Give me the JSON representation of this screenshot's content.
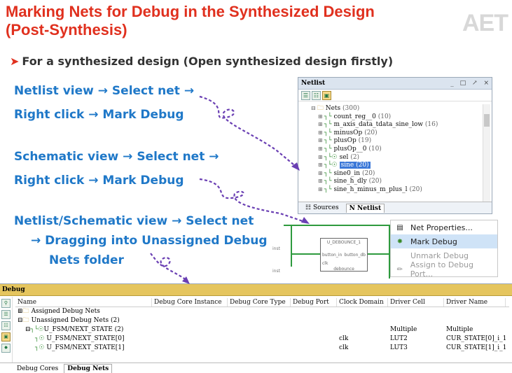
{
  "slide": {
    "title_line1": "Marking Nets for Debug in the Synthesized Design",
    "title_line2": "(Post-Synthesis)",
    "logo": "AET",
    "subtitle": "For a synthesized design (Open synthesized design firstly)",
    "instructions": [
      "Netlist view → Select net →",
      "Right click → Mark Debug",
      "Schematic view → Select net →",
      "Right click → Mark Debug",
      "Netlist/Schematic view → Select net",
      "→ Dragging into Unassigned Debug",
      "Nets folder"
    ],
    "accent_color": "#e0301e",
    "instruction_color": "#1f78c8",
    "arrow_color": "#6a3fb3"
  },
  "netlist": {
    "title": "Netlist",
    "window_buttons": [
      "_",
      "□",
      "↗",
      "×"
    ],
    "root": {
      "label": "Nets",
      "count": "(300)"
    },
    "items": [
      {
        "label": "count_reg__0",
        "count": "(10)",
        "selected": false
      },
      {
        "label": "m_axis_data_tdata_sine_low",
        "count": "(16)",
        "selected": false
      },
      {
        "label": "minusOp",
        "count": "(20)",
        "selected": false
      },
      {
        "label": "plusOp",
        "count": "(19)",
        "selected": false
      },
      {
        "label": "plusOp__0",
        "count": "(10)",
        "selected": false
      },
      {
        "label": "sel",
        "count": "(2)",
        "selected": false
      },
      {
        "label": "sine",
        "count": "(20)",
        "selected": true
      },
      {
        "label": "sine0_in",
        "count": "(20)",
        "selected": false
      },
      {
        "label": "sine_h_dly",
        "count": "(20)",
        "selected": false
      },
      {
        "label": "sine_h_minus_m_plus_l",
        "count": "(20)",
        "selected": false
      }
    ],
    "tabs": [
      "Sources",
      "Netlist"
    ]
  },
  "schematic": {
    "block_label": "U_DEBOUNCE_1",
    "port_in": "button_in",
    "port_out": "button_db",
    "clk": "clk",
    "block_name": "debounce",
    "inst1": "inst",
    "inst2": "inst"
  },
  "context_menu": {
    "items": [
      {
        "label": "Net Properties...",
        "icon": "properties-icon",
        "state": "normal"
      },
      {
        "label": "Mark Debug",
        "icon": "bug-icon",
        "state": "highlighted"
      },
      {
        "label": "Unmark Debug",
        "icon": "",
        "state": "disabled"
      },
      {
        "label": "Assign to Debug Port...",
        "icon": "brush-icon",
        "state": "disabled"
      }
    ]
  },
  "debug": {
    "title": "Debug",
    "columns": [
      "Name",
      "Debug Core Instance",
      "Debug Core Type",
      "Debug Port",
      "Clock Domain",
      "Driver Cell",
      "Driver Name"
    ],
    "rows": [
      {
        "name": "Assigned Debug Nets",
        "indent": 0,
        "cells": [
          "",
          "",
          "",
          "",
          "",
          ""
        ]
      },
      {
        "name": "Unassigned Debug Nets (2)",
        "indent": 0,
        "cells": [
          "",
          "",
          "",
          "",
          "",
          ""
        ]
      },
      {
        "name": "U_FSM/NEXT_STATE (2)",
        "indent": 1,
        "cells": [
          "",
          "",
          "",
          "",
          "Multiple",
          "Multiple"
        ]
      },
      {
        "name": "U_FSM/NEXT_STATE[0]",
        "indent": 2,
        "cells": [
          "",
          "",
          "",
          "clk",
          "LUT2",
          "CUR_STATE[0]_i_1"
        ]
      },
      {
        "name": "U_FSM/NEXT_STATE[1]",
        "indent": 2,
        "cells": [
          "",
          "",
          "",
          "clk",
          "LUT3",
          "CUR_STATE[1]_i_1"
        ]
      }
    ],
    "tabs": [
      "Debug Cores",
      "Debug Nets"
    ]
  }
}
